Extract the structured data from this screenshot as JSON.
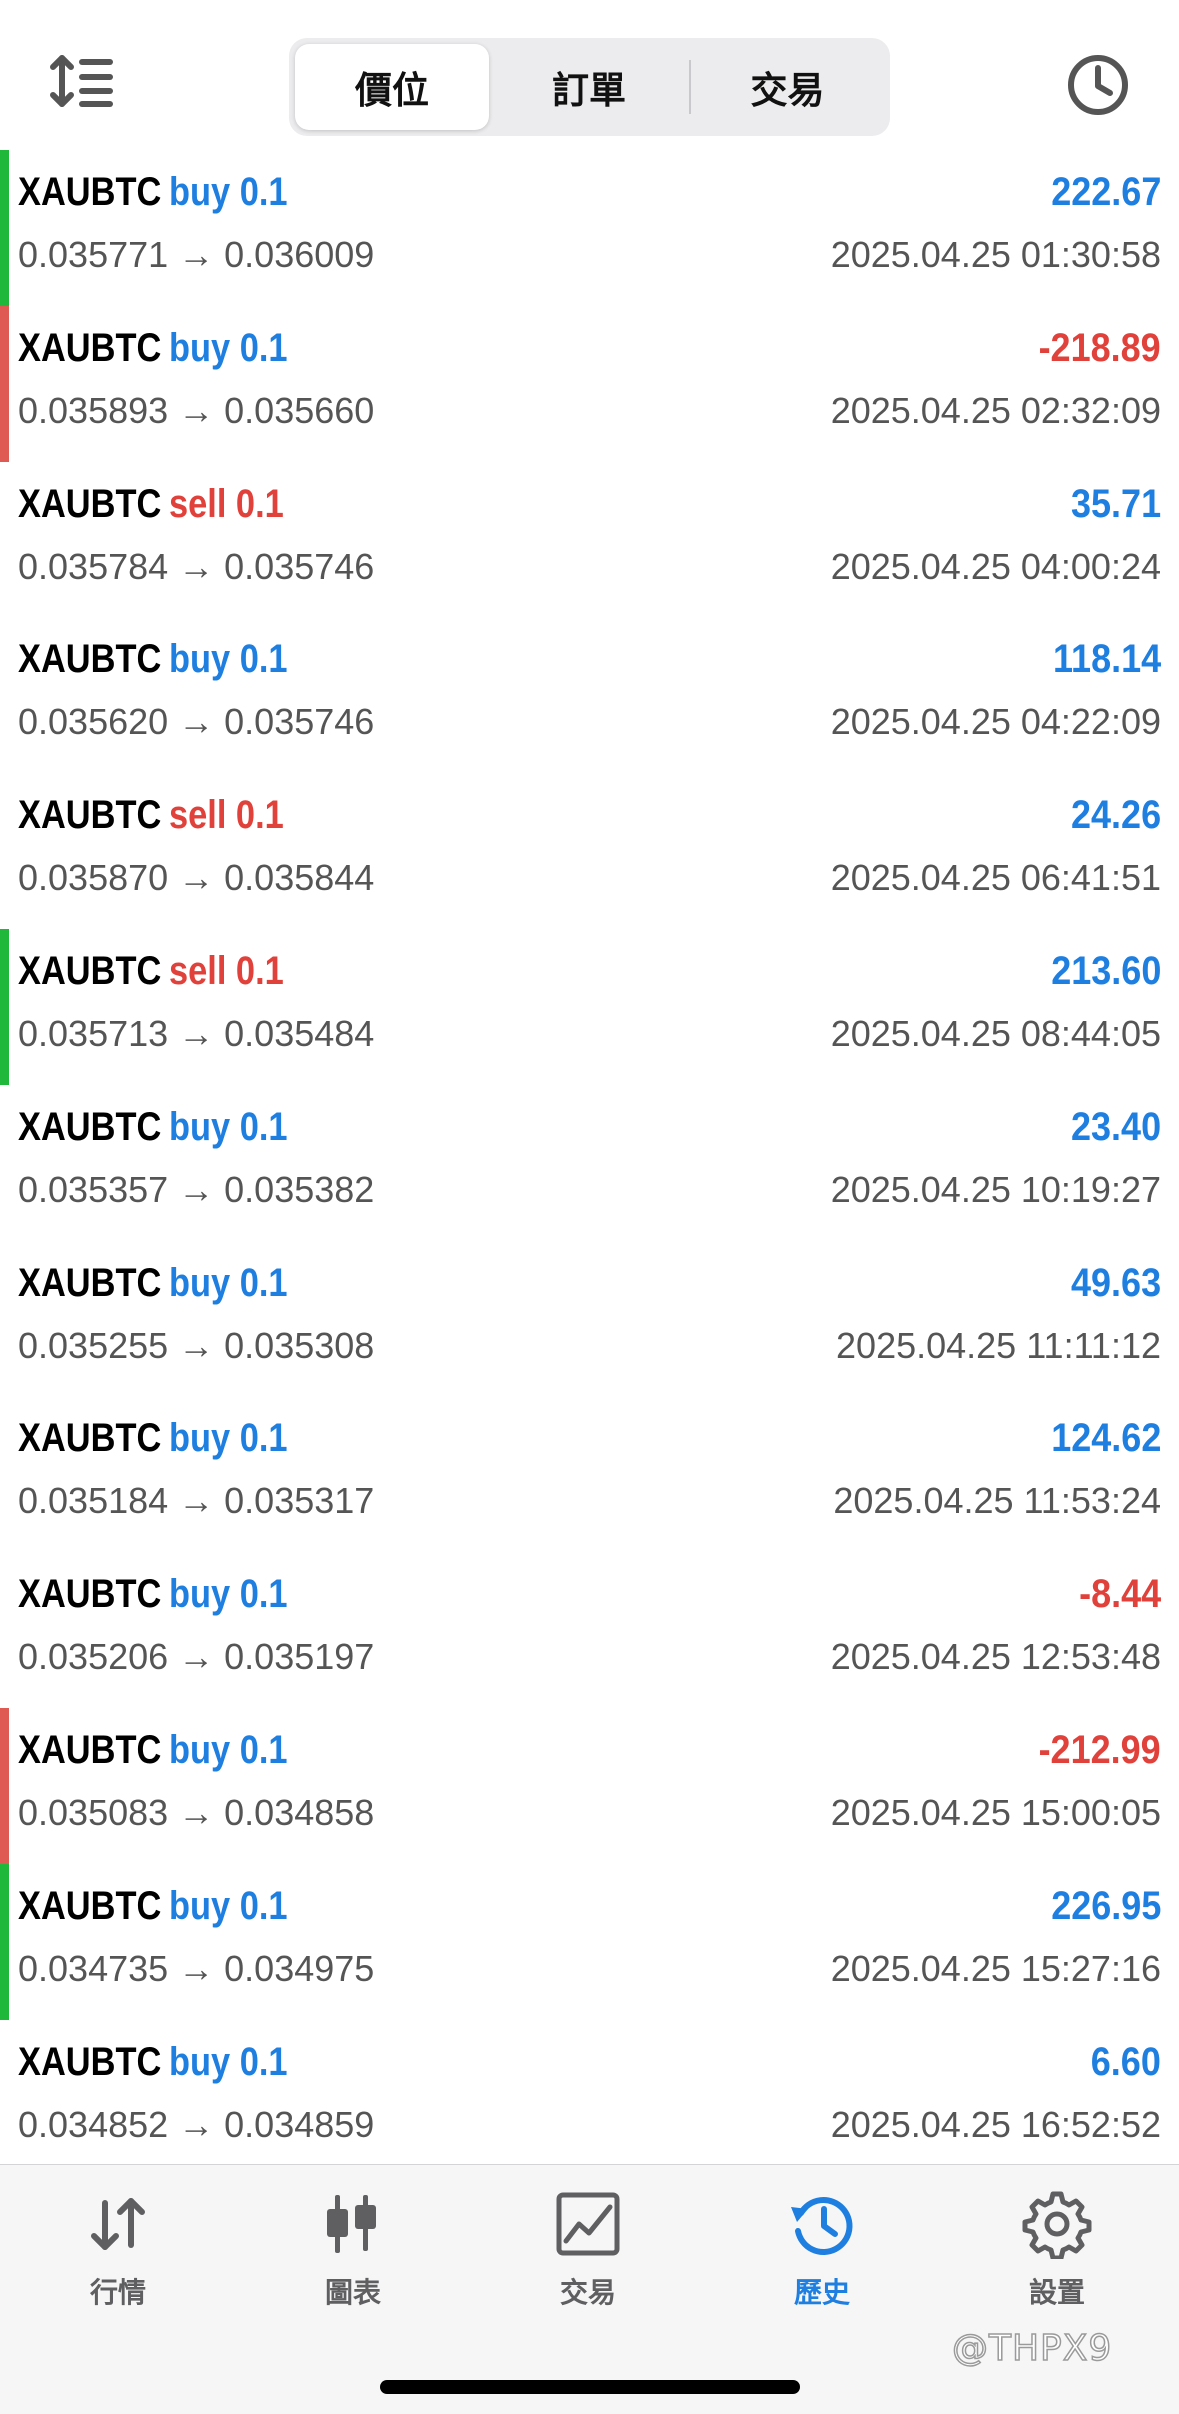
{
  "header": {
    "tabs": [
      {
        "label": "價位",
        "active": true
      },
      {
        "label": "訂單",
        "active": false
      },
      {
        "label": "交易",
        "active": false
      }
    ],
    "left_icon": "sort-icon",
    "right_icon": "clock-icon"
  },
  "colors": {
    "buy": "#1e7fe0",
    "sell": "#e0413a",
    "profit_positive": "#1e7fe0",
    "profit_negative": "#e0413a",
    "win_bar": "#1fb83b",
    "loss_bar": "#df5a52",
    "active_tab": "#1e7fe0"
  },
  "trades": [
    {
      "symbol": "XAUBTC",
      "side": "buy 0.1",
      "type": "buy",
      "profit": "222.67",
      "positive": true,
      "prices": "0.035771 → 0.036009",
      "time": "2025.04.25 01:30:58",
      "marker": "win"
    },
    {
      "symbol": "XAUBTC",
      "side": "buy 0.1",
      "type": "buy",
      "profit": "-218.89",
      "positive": false,
      "prices": "0.035893 → 0.035660",
      "time": "2025.04.25 02:32:09",
      "marker": "loss"
    },
    {
      "symbol": "XAUBTC",
      "side": "sell 0.1",
      "type": "sell",
      "profit": "35.71",
      "positive": true,
      "prices": "0.035784 → 0.035746",
      "time": "2025.04.25 04:00:24",
      "marker": "none"
    },
    {
      "symbol": "XAUBTC",
      "side": "buy 0.1",
      "type": "buy",
      "profit": "118.14",
      "positive": true,
      "prices": "0.035620 → 0.035746",
      "time": "2025.04.25 04:22:09",
      "marker": "none"
    },
    {
      "symbol": "XAUBTC",
      "side": "sell 0.1",
      "type": "sell",
      "profit": "24.26",
      "positive": true,
      "prices": "0.035870 → 0.035844",
      "time": "2025.04.25 06:41:51",
      "marker": "none"
    },
    {
      "symbol": "XAUBTC",
      "side": "sell 0.1",
      "type": "sell",
      "profit": "213.60",
      "positive": true,
      "prices": "0.035713 → 0.035484",
      "time": "2025.04.25 08:44:05",
      "marker": "win"
    },
    {
      "symbol": "XAUBTC",
      "side": "buy 0.1",
      "type": "buy",
      "profit": "23.40",
      "positive": true,
      "prices": "0.035357 → 0.035382",
      "time": "2025.04.25 10:19:27",
      "marker": "none"
    },
    {
      "symbol": "XAUBTC",
      "side": "buy 0.1",
      "type": "buy",
      "profit": "49.63",
      "positive": true,
      "prices": "0.035255 → 0.035308",
      "time": "2025.04.25 11:11:12",
      "marker": "none"
    },
    {
      "symbol": "XAUBTC",
      "side": "buy 0.1",
      "type": "buy",
      "profit": "124.62",
      "positive": true,
      "prices": "0.035184 → 0.035317",
      "time": "2025.04.25 11:53:24",
      "marker": "none"
    },
    {
      "symbol": "XAUBTC",
      "side": "buy 0.1",
      "type": "buy",
      "profit": "-8.44",
      "positive": false,
      "prices": "0.035206 → 0.035197",
      "time": "2025.04.25 12:53:48",
      "marker": "none"
    },
    {
      "symbol": "XAUBTC",
      "side": "buy 0.1",
      "type": "buy",
      "profit": "-212.99",
      "positive": false,
      "prices": "0.035083 → 0.034858",
      "time": "2025.04.25 15:00:05",
      "marker": "loss"
    },
    {
      "symbol": "XAUBTC",
      "side": "buy 0.1",
      "type": "buy",
      "profit": "226.95",
      "positive": true,
      "prices": "0.034735 → 0.034975",
      "time": "2025.04.25 15:27:16",
      "marker": "win"
    },
    {
      "symbol": "XAUBTC",
      "side": "buy 0.1",
      "type": "buy",
      "profit": "6.60",
      "positive": true,
      "prices": "0.034852 → 0.034859",
      "time": "2025.04.25 16:52:52",
      "marker": "none"
    }
  ],
  "tabbar": {
    "items": [
      {
        "label": "行情",
        "icon": "quotes-icon",
        "active": false
      },
      {
        "label": "圖表",
        "icon": "chart-icon",
        "active": false
      },
      {
        "label": "交易",
        "icon": "trade-icon",
        "active": false
      },
      {
        "label": "歷史",
        "icon": "history-icon",
        "active": true
      },
      {
        "label": "設置",
        "icon": "settings-icon",
        "active": false
      }
    ]
  },
  "watermark": "@THPX9"
}
